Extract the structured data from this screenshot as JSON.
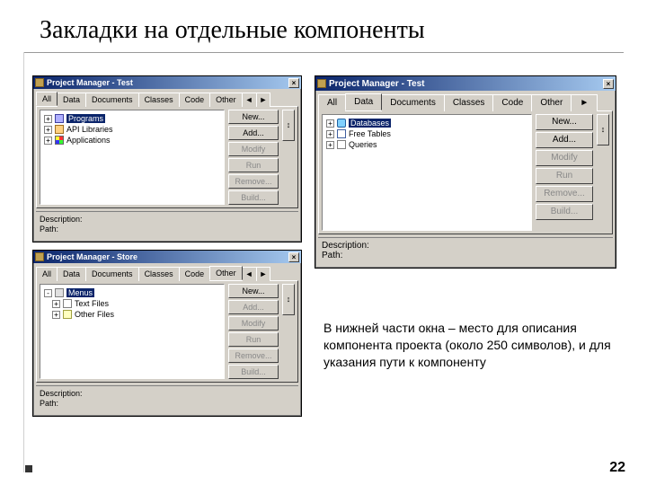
{
  "slide": {
    "title": "Закладки на отдельные компоненты",
    "page": "22",
    "caption": "В нижней части окна – место для описания компонента проекта (около 250 символов), и для указания пути к компоненту"
  },
  "common": {
    "tabs": {
      "all": "All",
      "data": "Data",
      "docs": "Documents",
      "classes": "Classes",
      "code": "Code",
      "other": "Other"
    },
    "extra": {
      "left": "◄",
      "right": "►"
    },
    "buttons": {
      "new": "New...",
      "add": "Add...",
      "modify": "Modify",
      "run": "Run",
      "remove": "Remove...",
      "build": "Build..."
    },
    "desc": {
      "description": "Description:",
      "path": "Path:"
    },
    "close": "×"
  },
  "win1": {
    "title": "Project Manager - Test",
    "items": [
      {
        "icon": "form",
        "label": "Programs",
        "sel": true,
        "pm": "+"
      },
      {
        "icon": "api",
        "label": "API Libraries",
        "pm": "+"
      },
      {
        "icon": "app",
        "label": "Applications",
        "pm": "+"
      }
    ]
  },
  "win2": {
    "title": "Project Manager - Store",
    "items": [
      {
        "icon": "menu",
        "label": "Menus",
        "sel": true,
        "pm": "-"
      },
      {
        "icon": "txt",
        "label": "Text Files",
        "pm": "+",
        "indent": true
      },
      {
        "icon": "oth",
        "label": "Other Files",
        "pm": "+",
        "indent": true
      }
    ]
  },
  "win3": {
    "title": "Project Manager - Test",
    "items": [
      {
        "icon": "db",
        "label": "Databases",
        "sel": true,
        "pm": "+"
      },
      {
        "icon": "tbl",
        "label": "Free Tables",
        "pm": "+"
      },
      {
        "icon": "qry",
        "label": "Queries",
        "pm": "+"
      }
    ]
  }
}
